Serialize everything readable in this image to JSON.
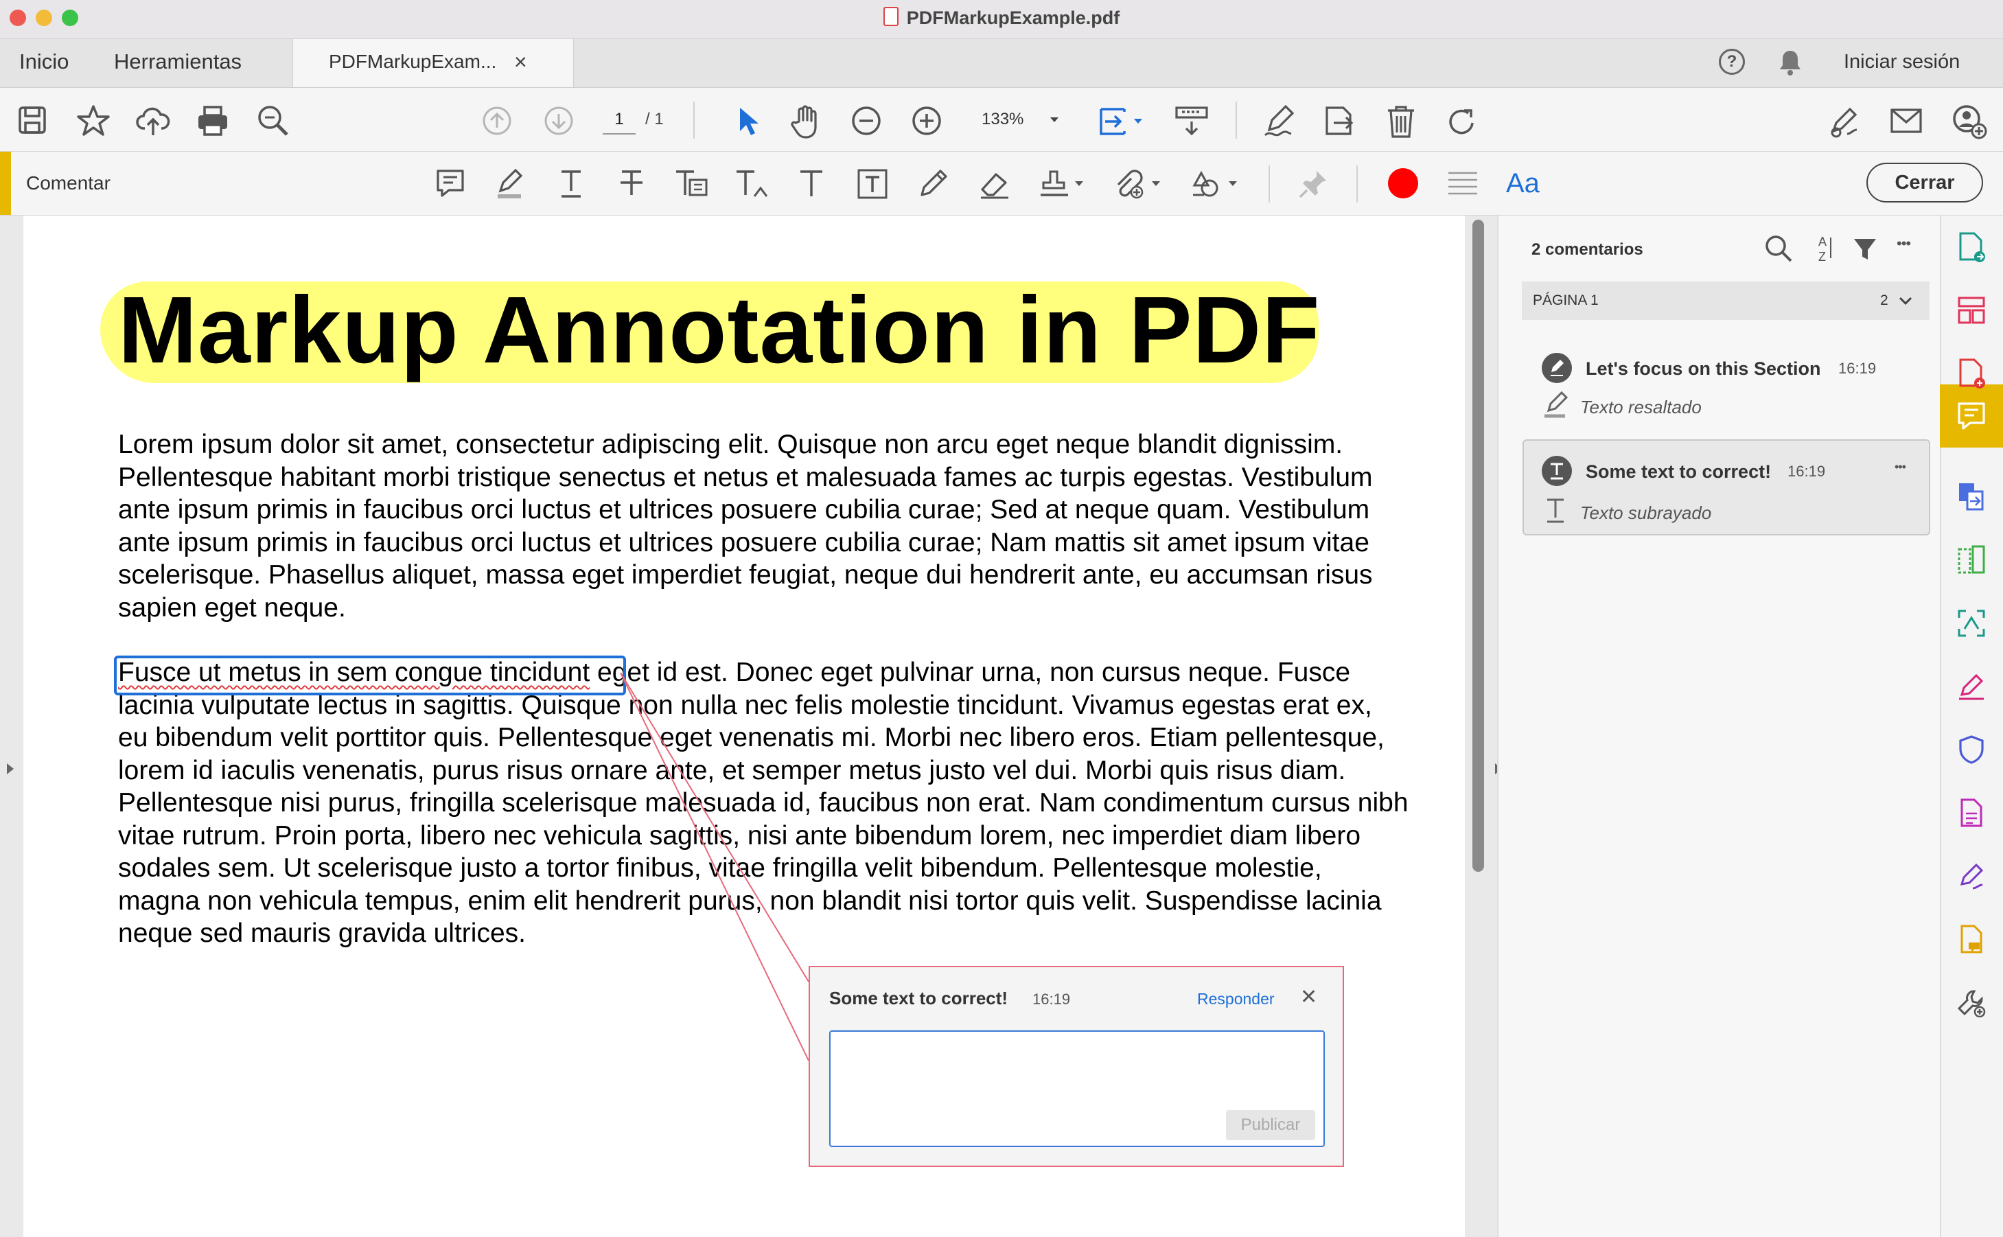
{
  "window": {
    "title": "PDFMarkupExample.pdf"
  },
  "tabs": {
    "home": "Inicio",
    "tools": "Herramientas",
    "document": "PDFMarkupExam...",
    "close_glyph": "×",
    "help_glyph": "?",
    "sign_in": "Iniciar sesión"
  },
  "toolbar": {
    "page_current": "1",
    "page_total": "/ 1",
    "zoom": "133%"
  },
  "comment_toolbar": {
    "label": "Comentar",
    "font_tool": "Aa",
    "close_button": "Cerrar",
    "color_accent": "#e6b800",
    "current_color": "#ff0000"
  },
  "document": {
    "title": "Markup Annotation in PDF",
    "paragraph1": "Lorem ipsum dolor sit amet, consectetur adipiscing elit. Quisque non arcu eget neque blandit dignissim. Pellentesque habitant morbi tristique senectus et netus et malesuada fames ac turpis egestas. Vestibulum ante ipsum primis in faucibus orci luctus et ultrices posuere cubilia curae; Sed at neque quam. Vestibulum ante ipsum primis in faucibus orci luctus et ultrices posuere cubilia curae; Nam mattis sit amet ipsum vitae scelerisque. Phasellus aliquet, massa eget imperdiet feugiat, neque dui hendrerit ante, eu accumsan risus sapien eget neque.",
    "paragraph2_underlined": "Fusce ut metus in sem congue tincidunt",
    "paragraph2_rest": " eget id est. Donec eget pulvinar urna, non cursus neque. Fusce lacinia vulputate lectus in sagittis. Quisque non nulla nec felis molestie tincidunt. Vivamus egestas erat ex, eu bibendum velit porttitor quis. Pellentesque eget venenatis mi. Morbi nec libero eros. Etiam pellentesque, lorem id iaculis venenatis, purus risus ornare ante, et semper metus justo vel dui. Morbi quis risus diam. Pellentesque nisi purus, fringilla scelerisque malesuada id, faucibus non erat. Nam condimentum cursus nibh vitae rutrum. Proin porta, libero nec vehicula sagittis, nisi ante bibendum lorem, nec imperdiet diam libero sodales sem. Ut scelerisque justo a tortor finibus, vitae fringilla velit bibendum. Pellentesque molestie, magna non vehicula tempus, enim elit hendrerit purus, non blandit nisi tortor quis velit. Suspendisse lacinia neque sed mauris gravida ultrices.",
    "highlight_color": "#ffff66"
  },
  "popup": {
    "title": "Some text to correct!",
    "time": "16:19",
    "reply": "Responder",
    "close_glyph": "✕",
    "publish": "Publicar"
  },
  "comments_panel": {
    "count_label": "2 comentarios",
    "more_glyph": "•••",
    "page_label": "PÁGINA 1",
    "page_count": "2",
    "items": [
      {
        "title": "Let's focus on this Section",
        "time": "16:19",
        "type": "Texto resaltado"
      },
      {
        "title": "Some text to correct!",
        "time": "16:19",
        "type": "Texto subrayado",
        "more": "•••"
      }
    ]
  }
}
